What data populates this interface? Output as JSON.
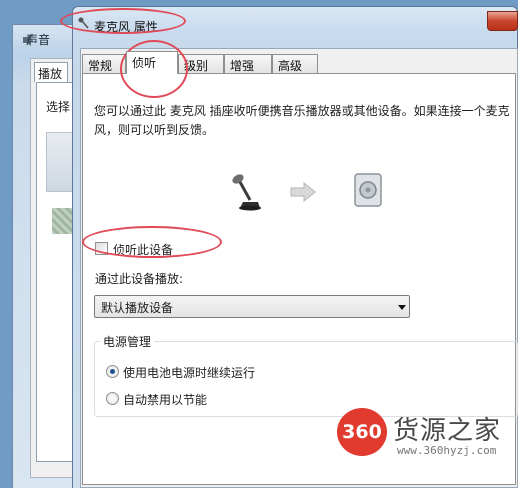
{
  "background_window": {
    "title": "声音",
    "tab": "播放",
    "select_label": "选择"
  },
  "window": {
    "title": "麦克风 属性"
  },
  "tabs": [
    {
      "label": "常规",
      "active": false
    },
    {
      "label": "侦听",
      "active": true
    },
    {
      "label": "级别",
      "active": false
    },
    {
      "label": "增强",
      "active": false
    },
    {
      "label": "高级",
      "active": false
    }
  ],
  "listen": {
    "description": "您可以通过此 麦克风 插座收听便携音乐播放器或其他设备。如果连接一个麦克风，则可以听到反馈。",
    "checkbox_label": "侦听此设备",
    "checkbox_checked": false,
    "playback_label": "通过此设备播放:",
    "playback_value": "默认播放设备"
  },
  "power": {
    "group_label": "电源管理",
    "options": [
      {
        "label": "使用电池电源时继续运行",
        "selected": true
      },
      {
        "label": "自动禁用以节能",
        "selected": false
      }
    ]
  },
  "watermark": {
    "logo": "360",
    "text": "货源之家",
    "url": "www.360hyzj.com"
  },
  "colors": {
    "annotation": "#e04a57",
    "accent": "#1d4f91",
    "watermark_red": "#e13a2e"
  }
}
